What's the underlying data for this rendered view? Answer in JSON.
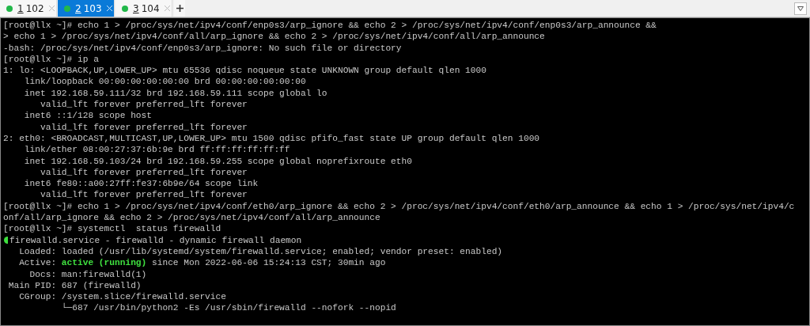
{
  "tabs": [
    {
      "index": "1",
      "name": "102",
      "selected": false
    },
    {
      "index": "2",
      "name": "103",
      "selected": true
    },
    {
      "index": "3",
      "name": "104",
      "selected": false
    }
  ],
  "terminal": {
    "lines": [
      {
        "text": "[root@llx ~]# echo 1 > /proc/sys/net/ipv4/conf/enp0s3/arp_ignore && echo 2 > /proc/sys/net/ipv4/conf/enp0s3/arp_announce &&"
      },
      {
        "text": "> echo 1 > /proc/sys/net/ipv4/conf/all/arp_ignore && echo 2 > /proc/sys/net/ipv4/conf/all/arp_announce"
      },
      {
        "text": "-bash: /proc/sys/net/ipv4/conf/enp0s3/arp_ignore: No such file or directory"
      },
      {
        "text": "[root@llx ~]# ip a"
      },
      {
        "text": "1: lo: <LOOPBACK,UP,LOWER_UP> mtu 65536 qdisc noqueue state UNKNOWN group default qlen 1000"
      },
      {
        "text": "    link/loopback 00:00:00:00:00:00 brd 00:00:00:00:00:00"
      },
      {
        "text": "    inet 192.168.59.111/32 brd 192.168.59.111 scope global lo"
      },
      {
        "text": "       valid_lft forever preferred_lft forever"
      },
      {
        "text": "    inet6 ::1/128 scope host"
      },
      {
        "text": "       valid_lft forever preferred_lft forever"
      },
      {
        "text": "2: eth0: <BROADCAST,MULTICAST,UP,LOWER_UP> mtu 1500 qdisc pfifo_fast state UP group default qlen 1000"
      },
      {
        "text": "    link/ether 08:00:27:37:6b:9e brd ff:ff:ff:ff:ff:ff"
      },
      {
        "text": "    inet 192.168.59.103/24 brd 192.168.59.255 scope global noprefixroute eth0"
      },
      {
        "text": "       valid_lft forever preferred_lft forever"
      },
      {
        "text": "    inet6 fe80::a00:27ff:fe37:6b9e/64 scope link"
      },
      {
        "text": "       valid_lft forever preferred_lft forever"
      },
      {
        "text": "[root@llx ~]# echo 1 > /proc/sys/net/ipv4/conf/eth0/arp_ignore && echo 2 > /proc/sys/net/ipv4/conf/eth0/arp_announce && echo 1 > /proc/sys/net/ipv4/c"
      },
      {
        "text": "onf/all/arp_ignore && echo 2 > /proc/sys/net/ipv4/conf/all/arp_announce"
      },
      {
        "text": "[root@llx ~]# systemctl  status firewalld"
      },
      {
        "text": "firewalld.service - firewalld - dynamic firewall daemon",
        "status_dot": true
      },
      {
        "text": "   Loaded: loaded (/usr/lib/systemd/system/firewalld.service; enabled; vendor preset: enabled)"
      },
      {
        "segments": [
          {
            "text": "   Active: ",
            "highlight": false
          },
          {
            "text": "active (running)",
            "highlight": true
          },
          {
            "text": " since Mon 2022-06-06 15:24:13 CST; 30min ago",
            "highlight": false
          }
        ]
      },
      {
        "text": "     Docs: man:firewalld(1)"
      },
      {
        "text": " Main PID: 687 (firewalld)"
      },
      {
        "text": "   CGroup: /system.slice/firewalld.service"
      },
      {
        "text": "           └─687 /usr/bin/python2 -Es /usr/sbin/firewalld --nofork --nopid"
      }
    ]
  }
}
